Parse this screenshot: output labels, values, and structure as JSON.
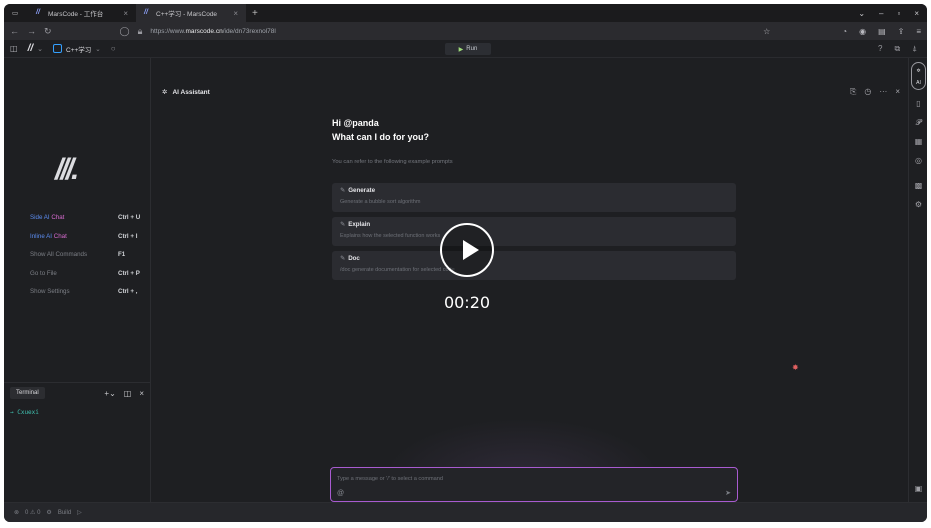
{
  "browser": {
    "tabs": [
      {
        "label": "MarsCode - 工作台"
      },
      {
        "label": "C++学习 - MarsCode"
      }
    ],
    "url_prefix": "https://www.",
    "url_domain": "marscode.cn",
    "url_path": "/ide/dn73rexnol78l"
  },
  "ide": {
    "project_name": "C++学习",
    "run_label": "Run"
  },
  "shortcuts": [
    {
      "label_a": "Side AI",
      "label_b": " Chat",
      "keys": "Ctrl + U",
      "highlight": true
    },
    {
      "label_a": "Inline AI",
      "label_b": " Chat",
      "keys": "Ctrl + I",
      "highlight": true
    },
    {
      "label_a": "Show All Commands",
      "label_b": "",
      "keys": "F1",
      "highlight": false
    },
    {
      "label_a": "Go to File",
      "label_b": "",
      "keys": "Ctrl + P",
      "highlight": false
    },
    {
      "label_a": "Show Settings",
      "label_b": "",
      "keys": "Ctrl + ,",
      "highlight": false
    }
  ],
  "terminal": {
    "tab_label": "Terminal",
    "prompt_line": "→ Cxuexi"
  },
  "assistant": {
    "title": "AI Assistant",
    "greeting": "Hi @panda",
    "question": "What can I do for you?",
    "hint": "You can refer to the following example prompts",
    "prompts": [
      {
        "title": "Generate",
        "desc": "Generate a bubble sort algorithm"
      },
      {
        "title": "Explain",
        "desc": "Explains how the selected function works"
      },
      {
        "title": "Doc",
        "desc": "/doc generate documentation for selected code"
      }
    ],
    "input_placeholder": "Type a message or '/' to select a command"
  },
  "video": {
    "timestamp": "00:20"
  },
  "rail": {
    "ai_label": "AI"
  },
  "status": {
    "counts": "0 ⚠ 0",
    "build": "Build"
  }
}
